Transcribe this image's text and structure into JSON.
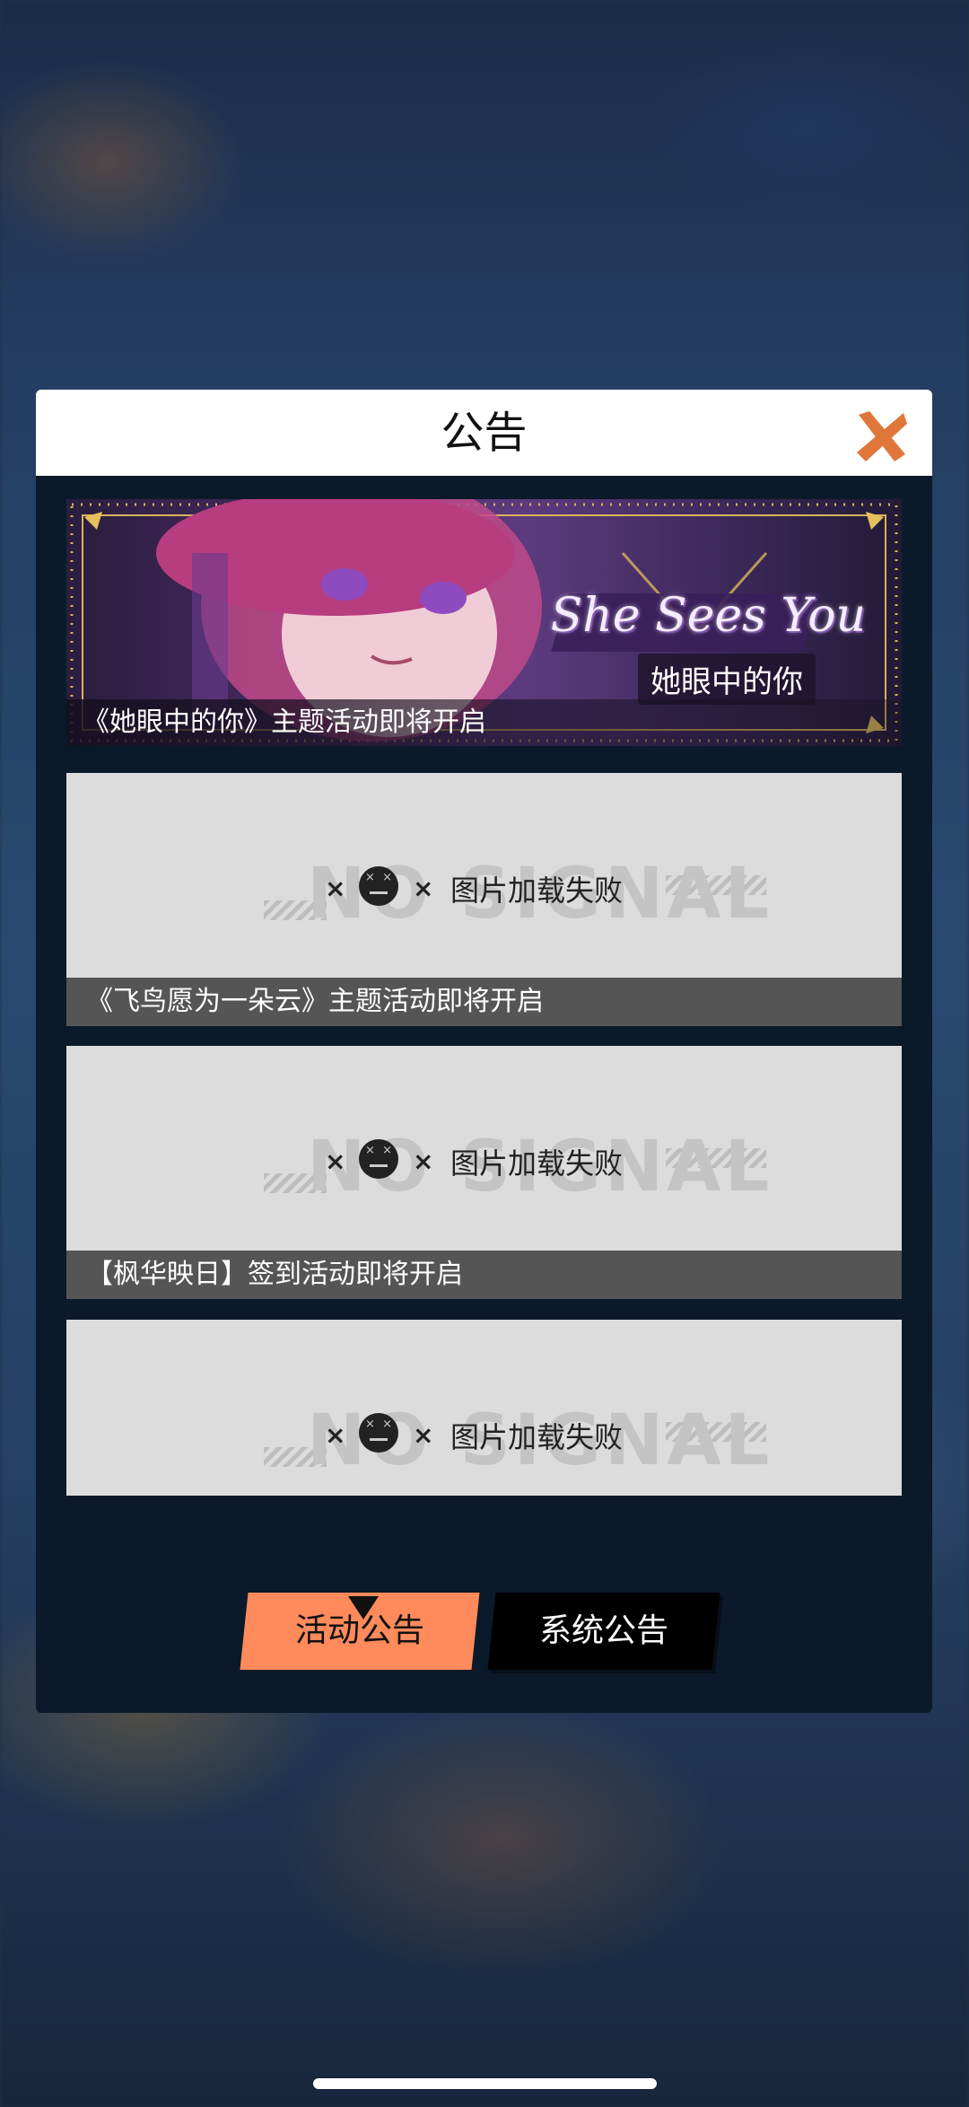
{
  "dialog": {
    "title": "公告",
    "close_icon": "close-x-icon",
    "accent_color": "#e0773a"
  },
  "announcements": [
    {
      "caption": "《她眼中的你》主题活动即将开启",
      "banner_logo": "She Sees You",
      "banner_subtitle": "她眼中的你",
      "image_loaded": true
    },
    {
      "caption": "《飞鸟愿为一朵云》主题活动即将开启",
      "image_loaded": false,
      "placeholder_bg_text": "NO SIGNAL",
      "placeholder_message": "图片加载失败"
    },
    {
      "caption": "【枫华映日】签到活动即将开启",
      "image_loaded": false,
      "placeholder_bg_text": "NO SIGNAL",
      "placeholder_message": "图片加载失败"
    },
    {
      "caption": "",
      "image_loaded": false,
      "placeholder_bg_text": "NO SIGNAL",
      "placeholder_message": "图片加载失败"
    }
  ],
  "tabs": [
    {
      "label": "活动公告",
      "active": true,
      "color": "#ff8a5b"
    },
    {
      "label": "系统公告",
      "active": false,
      "color": "#000000"
    }
  ]
}
